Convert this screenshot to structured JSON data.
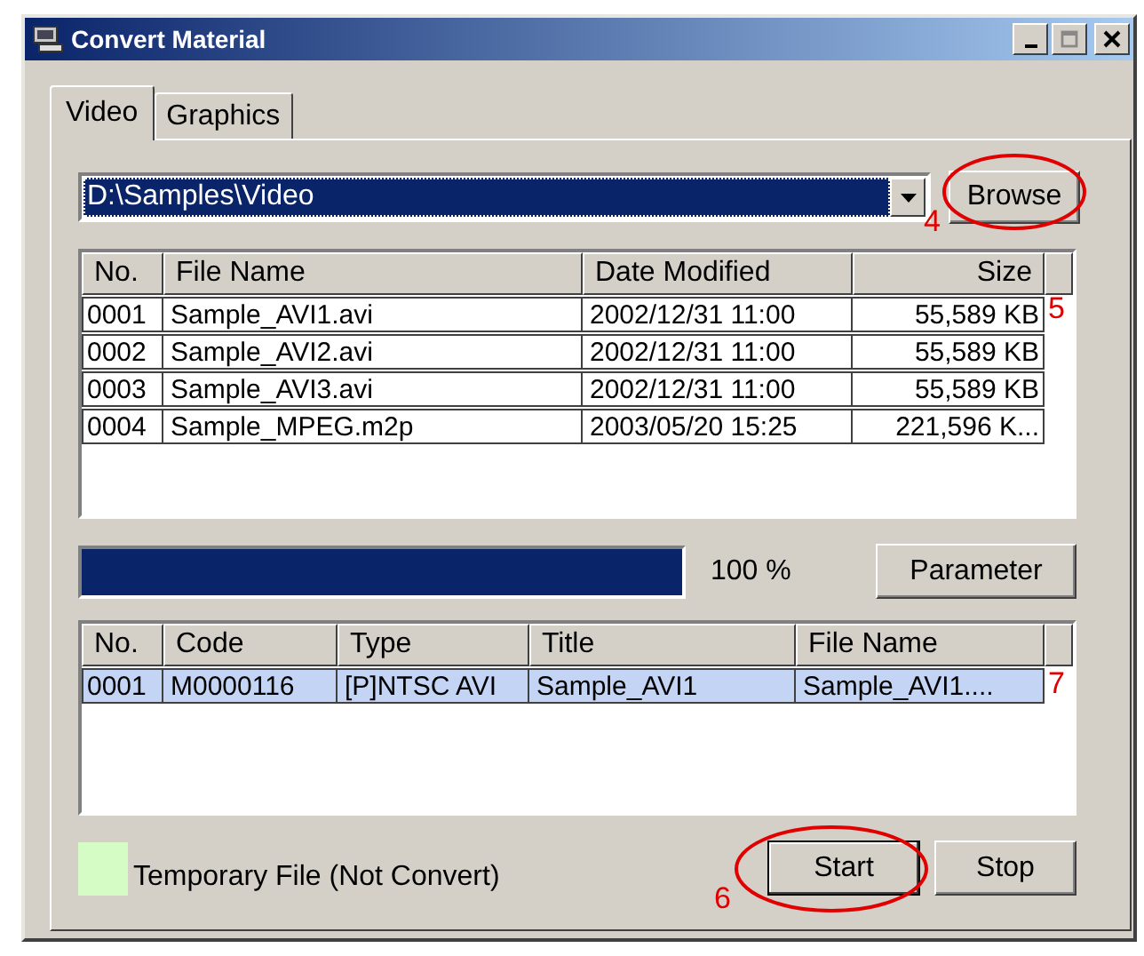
{
  "window": {
    "title": "Convert Material"
  },
  "tabs": [
    {
      "label": "Video",
      "selected": true
    },
    {
      "label": "Graphics",
      "selected": false
    }
  ],
  "folder": {
    "value": "D:\\Samples\\Video",
    "selected": true
  },
  "browse_button": "Browse",
  "files": {
    "columns": [
      "No.",
      "File Name",
      "Date Modified",
      "Size"
    ],
    "rows": [
      {
        "cells": [
          "0001",
          "Sample_AVI1.avi",
          "2002/12/31 11:00",
          "55,589 KB"
        ],
        "selected": false
      },
      {
        "cells": [
          "0002",
          "Sample_AVI2.avi",
          "2002/12/31 11:00",
          "55,589 KB"
        ],
        "selected": false
      },
      {
        "cells": [
          "0003",
          "Sample_AVI3.avi",
          "2002/12/31 11:00",
          "55,589 KB"
        ],
        "selected": false
      },
      {
        "cells": [
          "0004",
          "Sample_MPEG.m2p",
          "2003/05/20 15:25",
          "221,596 K..."
        ],
        "selected": false
      }
    ]
  },
  "progress": {
    "level": 1,
    "reading": "100 %"
  },
  "parameter_button": "Parameter",
  "queue": {
    "columns": [
      "No.",
      "Code",
      "Type",
      "Title",
      "File Name"
    ],
    "rows": [
      {
        "cells": [
          "0001",
          "M0000116",
          "[P]NTSC AVI",
          "Sample_AVI1",
          "Sample_AVI1...."
        ],
        "selected": true
      }
    ]
  },
  "legend": {
    "color": "#d4fcc4",
    "label": "Temporary File (Not Convert)"
  },
  "buttons": [
    "Start",
    "Stop"
  ],
  "annotations": [
    {
      "label": "4",
      "circled": true
    },
    {
      "label": "5",
      "circled": false
    },
    {
      "label": "6",
      "circled": true
    },
    {
      "label": "7",
      "circled": false
    }
  ]
}
